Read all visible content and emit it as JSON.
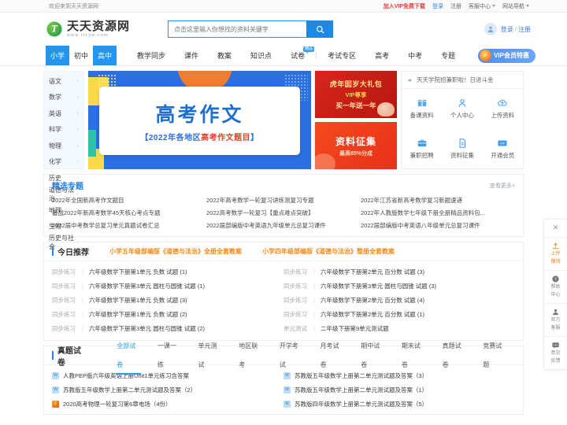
{
  "topbar": {
    "welcome": "欢迎来到天天资源网",
    "vip_link": "加入VIP免费下载",
    "login": "登录",
    "register": "注册",
    "service": "客服中心",
    "sitemap": "网站导航"
  },
  "header": {
    "logo_cn": "天天资源网",
    "logo_en": "www.ttzyw.com",
    "logo_letter": "T",
    "search_placeholder": "点击这里输入你想找的资料关键字",
    "search_value": "",
    "search_icon": "search-icon",
    "login": "登录",
    "separator": "/",
    "register": "注册"
  },
  "nav": {
    "stages": [
      {
        "label": "小学",
        "active": true
      },
      {
        "label": "初中",
        "active": false
      },
      {
        "label": "高中",
        "active": true
      }
    ],
    "items": [
      {
        "label": "教学同步",
        "badge": ""
      },
      {
        "label": "课件",
        "badge": ""
      },
      {
        "label": "教案",
        "badge": ""
      },
      {
        "label": "知识点",
        "badge": ""
      },
      {
        "label": "试卷",
        "badge": "精品"
      },
      {
        "label": "考试专区",
        "badge": ""
      },
      {
        "label": "高考",
        "badge": ""
      },
      {
        "label": "中考",
        "badge": ""
      },
      {
        "label": "专题",
        "badge": ""
      }
    ],
    "vip_button": "VIP会员特惠"
  },
  "sidebar": {
    "items": [
      {
        "label": "语文"
      },
      {
        "label": "数学"
      },
      {
        "label": "英语"
      },
      {
        "label": "科学"
      },
      {
        "label": "物理"
      },
      {
        "label": "化学"
      },
      {
        "label": "历史"
      },
      {
        "label": "道德与法治"
      },
      {
        "label": "地理"
      },
      {
        "label": "生物"
      },
      {
        "label": "历史与社会"
      }
    ],
    "arrow": "›"
  },
  "banner": {
    "title": "高考作文",
    "sub_prefix": "【2022年各地区",
    "sub_highlight": "高考作文题目",
    "sub_suffix": "】"
  },
  "ads": [
    {
      "line1": "虎年囡岁大礼包",
      "line2": "VIP尊享",
      "line3": "买一年送一年"
    },
    {
      "line1": "资料征集",
      "line2": "最高85%分成"
    }
  ],
  "quick_panel": {
    "notice_icon": "megaphone-icon",
    "notice": "天天学院招兼职啦！日进斗金",
    "cells": [
      {
        "label": "备课资料",
        "icon": "book-icon"
      },
      {
        "label": "个人中心",
        "icon": "user-icon"
      },
      {
        "label": "上传资料",
        "icon": "cloud-upload-icon"
      },
      {
        "label": "兼职招聘",
        "icon": "briefcase-icon"
      },
      {
        "label": "资料征集",
        "icon": "document-icon"
      },
      {
        "label": "开通会员",
        "icon": "vip-card-icon"
      }
    ]
  },
  "featured": {
    "title": "精选专题",
    "more": "查看更多>",
    "items": [
      "2022年全国新高考作文题目",
      "2022年高考数学一轮复习讲练测复习专题",
      "2022年江苏省新高考数学复习新题速递",
      "备战2022年新高考数学45天核心考点专题",
      "2022高考数学一轮复习【重点难点突破】",
      "2022年人教版数学七年级下册全册精品资料包...",
      "2022届中考数学总复习单元真题试卷汇总",
      "2022届部编版中考英语九年级单元总复习课件",
      "2022届部编版中考英语八年级单元总复习课件"
    ]
  },
  "today": {
    "title": "今日推荐",
    "hot_links": [
      "小学五年级部编版《道德与法治》全册全套教案",
      "小学四年级部编版《道德与法治》整册全套教案"
    ],
    "left_items": [
      {
        "tag": "同步练习",
        "text": "六年级数学下册第1单元 负数 试题 (1)"
      },
      {
        "tag": "同步练习",
        "text": "六年级数学下册第3单元 圆柱与圆锥 试题 (1)"
      },
      {
        "tag": "同步练习",
        "text": "六年级数学下册第1单元 负数 试题 (3)"
      },
      {
        "tag": "同步练习",
        "text": "六年级数学下册第1单元 负数 试题 (2)"
      },
      {
        "tag": "同步练习",
        "text": "六年级数学下册第3单元 圆柱与圆锥 试题 (2)"
      }
    ],
    "right_items": [
      {
        "tag": "同步练习",
        "text": "六年级数学下册第2单元 百分数 试题 (3)"
      },
      {
        "tag": "同步练习",
        "text": "六年级数学下册第3单元 圆柱与圆锥 试题 (3)"
      },
      {
        "tag": "同步练习",
        "text": "六年级数学下册第2单元 百分数 试题 (4)"
      },
      {
        "tag": "同步练习",
        "text": "六年级数学下册第2单元 百分数 试题 (1)"
      },
      {
        "tag": "单元测试",
        "text": "二年级下册第9单元测试题"
      }
    ]
  },
  "papers": {
    "title": "真题试卷",
    "tabs": [
      {
        "label": "全部试卷",
        "active": true
      },
      {
        "label": "一课一练",
        "active": false
      },
      {
        "label": "单元测试",
        "active": false
      },
      {
        "label": "地区联考",
        "active": false
      },
      {
        "label": "开学考试",
        "active": false
      },
      {
        "label": "月考试卷",
        "active": false
      },
      {
        "label": "期中试卷",
        "active": false
      },
      {
        "label": "期末试卷",
        "active": false
      },
      {
        "label": "真题试卷",
        "active": false
      },
      {
        "label": "竞赛试题",
        "active": false
      }
    ],
    "left_items": [
      {
        "type": "word",
        "icon_label": "W",
        "text": "人教PEP版六年级英语上册Unit1单元练习含答案"
      },
      {
        "type": "word",
        "icon_label": "W",
        "text": "苏教版五年级数学上册第二单元测试题及答案（2）"
      },
      {
        "type": "zip",
        "icon_label": "Z",
        "text": "2020高考物理一轮复习第6章电场（4份）"
      }
    ],
    "right_items": [
      {
        "type": "word",
        "icon_label": "W",
        "text": "苏教版五年级数学上册第二单元测试题及答案（3）"
      },
      {
        "type": "word",
        "icon_label": "W",
        "text": "苏教版五年级数学上册第二单元测试题及答案（1）"
      },
      {
        "type": "word",
        "icon_label": "W",
        "text": "苏教版四年级数学上册第二单元测试题及答案（5）"
      }
    ]
  },
  "floatbar": {
    "close_icon": "close-icon",
    "items": [
      {
        "label": "上传\n赚钱",
        "line1": "上传",
        "line2": "赚钱",
        "icon": "upload-icon"
      },
      {
        "line1": "帮助",
        "line2": "中心",
        "icon": "help-icon"
      },
      {
        "line1": "官方",
        "line2": "客服",
        "icon": "headset-icon"
      },
      {
        "line1": "意见",
        "line2": "反馈",
        "icon": "feedback-icon"
      }
    ]
  },
  "colors": {
    "brand_blue": "#2196f3",
    "accent_red": "#e4393c",
    "accent_orange": "#ef8b1f",
    "logo_green": "#2e9e4f"
  }
}
